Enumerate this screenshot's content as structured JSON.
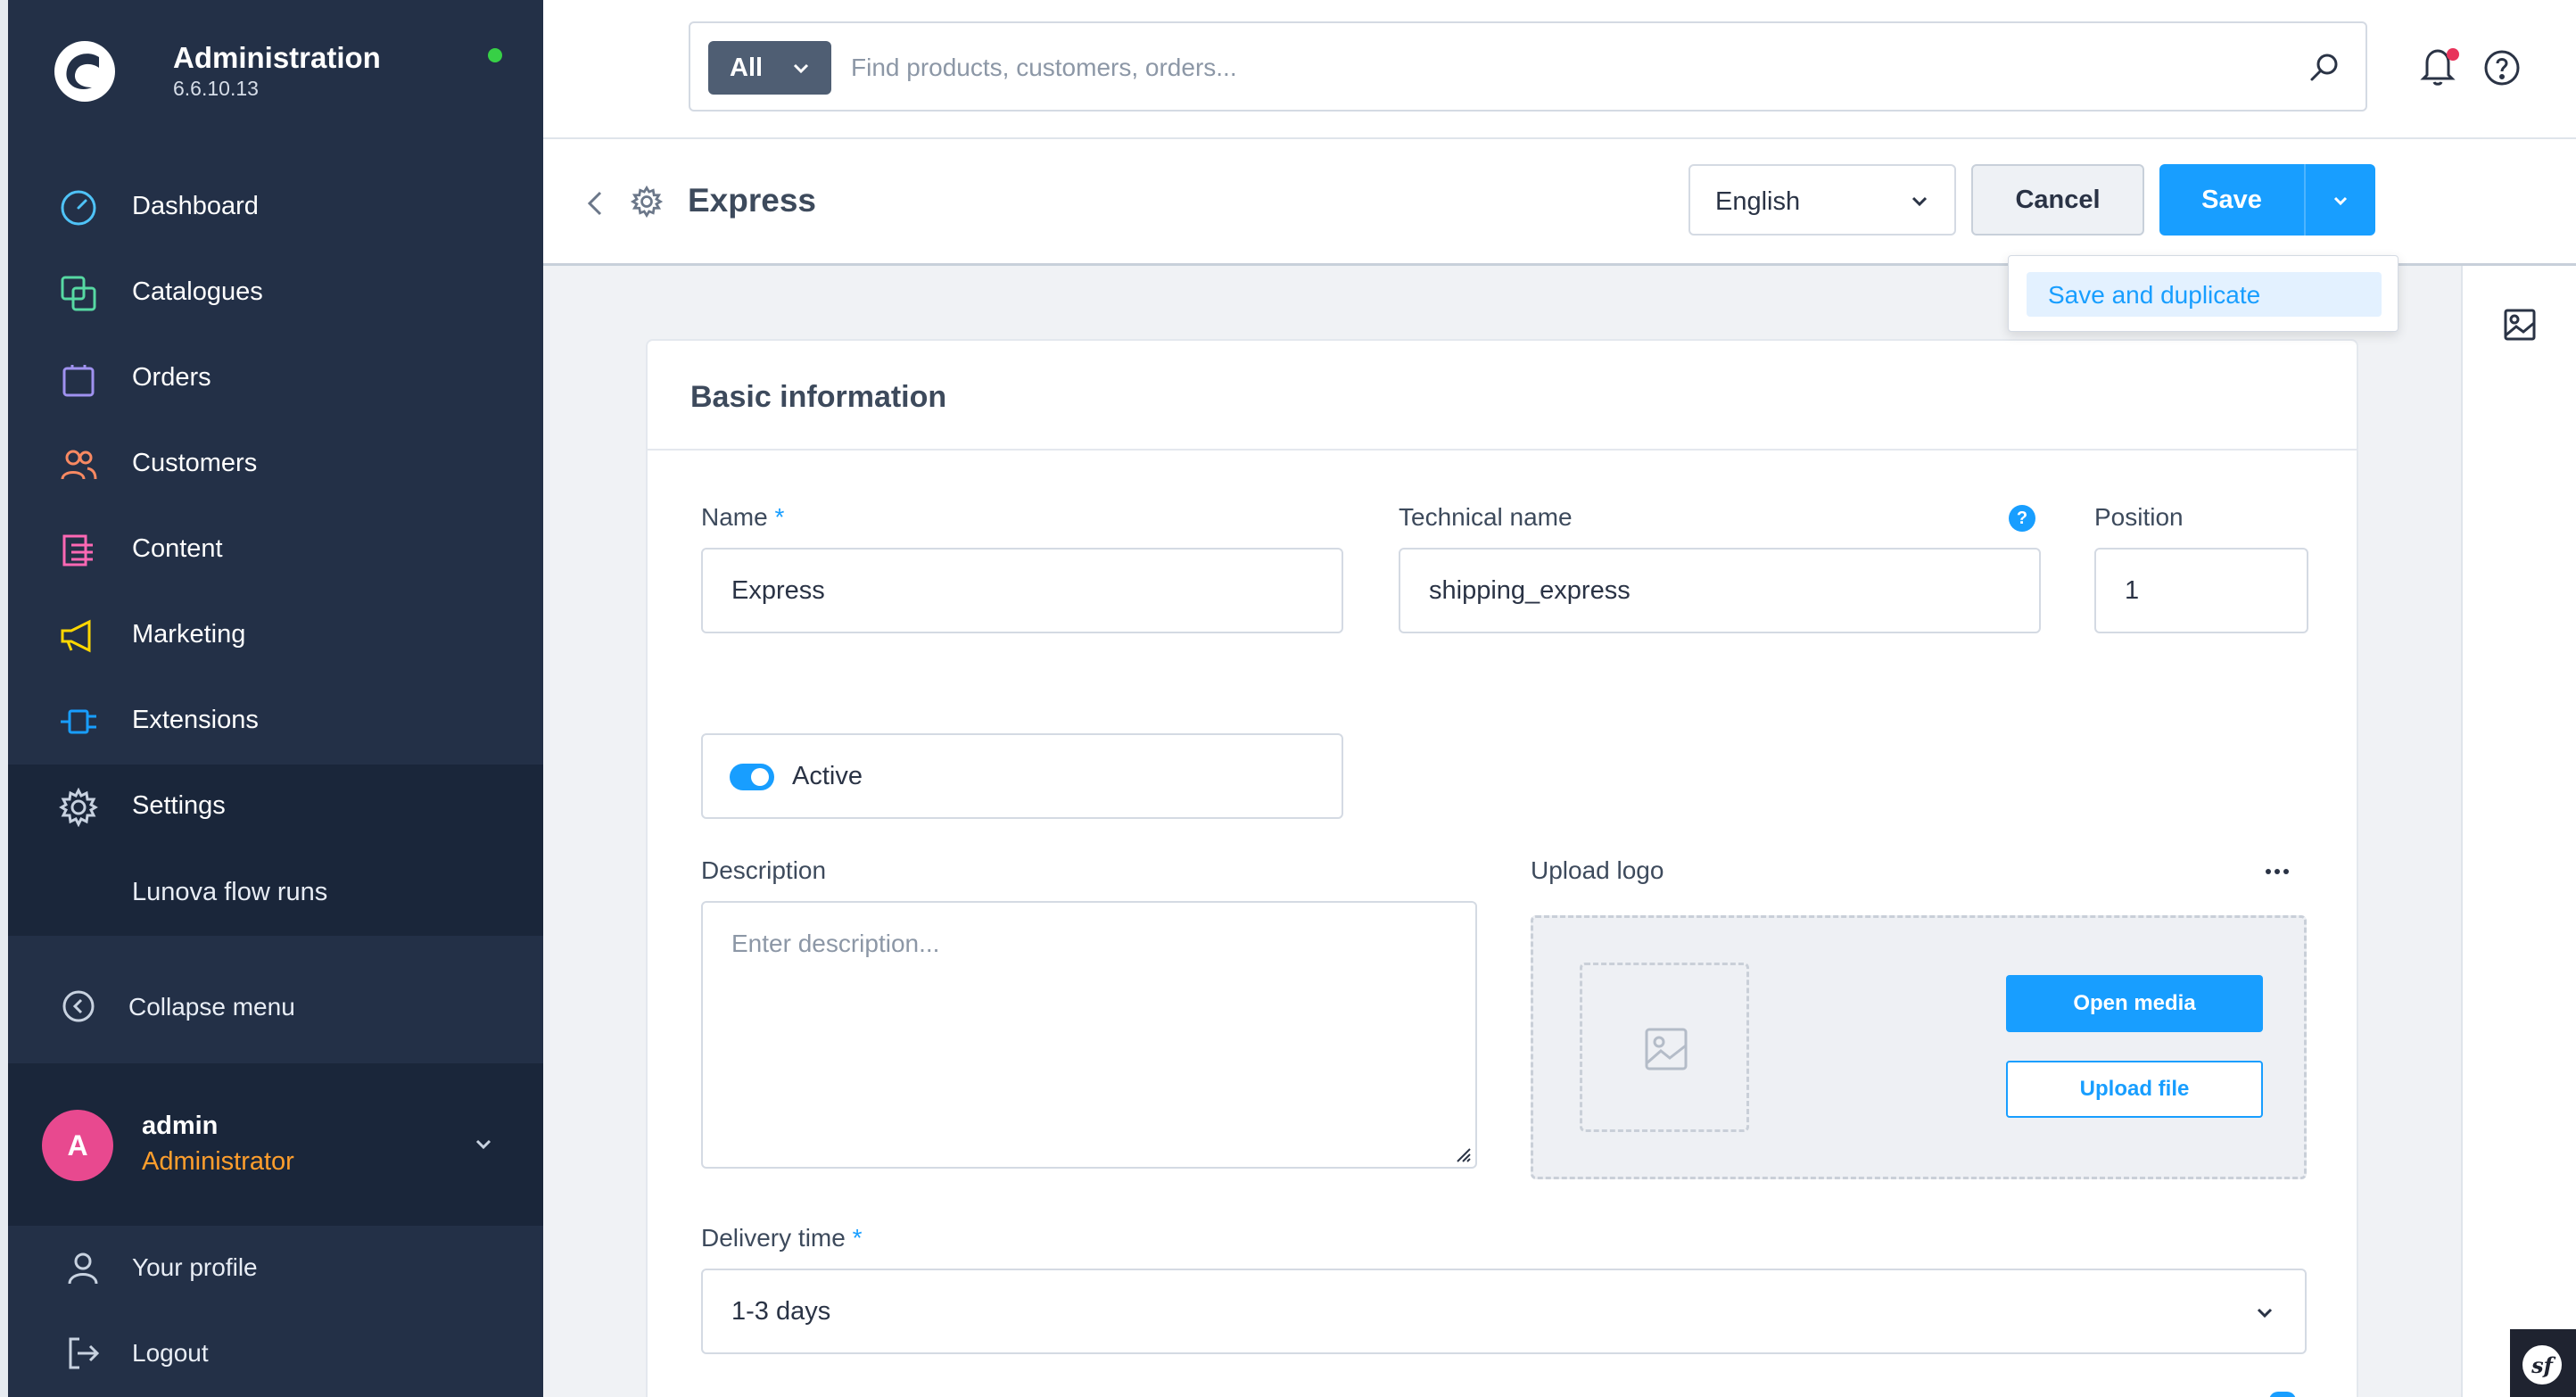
{
  "brand": {
    "title": "Administration",
    "version": "6.6.10.13"
  },
  "sidebar": {
    "items": [
      {
        "label": "Dashboard",
        "icon": "gauge-icon",
        "color": "#4fc3f7"
      },
      {
        "label": "Catalogues",
        "icon": "catalogue-icon",
        "color": "#57d9a3"
      },
      {
        "label": "Orders",
        "icon": "bag-icon",
        "color": "#a092f0"
      },
      {
        "label": "Customers",
        "icon": "users-icon",
        "color": "#f88962"
      },
      {
        "label": "Content",
        "icon": "content-icon",
        "color": "#ff68b4"
      },
      {
        "label": "Marketing",
        "icon": "megaphone-icon",
        "color": "#ffd700"
      },
      {
        "label": "Extensions",
        "icon": "plug-icon",
        "color": "#189eff"
      },
      {
        "label": "Settings",
        "icon": "gear-icon",
        "color": "#9aa8bd"
      }
    ],
    "sub_item": "Lunova flow runs",
    "collapse_label": "Collapse menu"
  },
  "user": {
    "initial": "A",
    "name": "admin",
    "role": "Administrator"
  },
  "account": {
    "profile_label": "Your profile",
    "logout_label": "Logout"
  },
  "search": {
    "scope": "All",
    "placeholder": "Find products, customers, orders..."
  },
  "header": {
    "title": "Express",
    "language": "English",
    "cancel_label": "Cancel",
    "save_label": "Save",
    "dropdown_item": "Save and duplicate"
  },
  "card": {
    "title": "Basic information",
    "name_label": "Name",
    "name_value": "Express",
    "technical_name_label": "Technical name",
    "technical_name_value": "shipping_express",
    "info_mark": "?",
    "position_label": "Position",
    "position_value": "1",
    "active_label": "Active",
    "active": true,
    "required_mark": "*",
    "description_label": "Description",
    "description_placeholder": "Enter description...",
    "upload_logo_label": "Upload logo",
    "open_media_label": "Open media",
    "upload_file_label": "Upload file",
    "delivery_time_label": "Delivery time",
    "delivery_time_value": "1-3 days"
  },
  "misc": {
    "symfony_mark": "sf"
  },
  "colors": {
    "accent": "#189eff",
    "sidebar_bg": "#233047",
    "role": "#ff9e2c",
    "avatar": "#e8498f"
  }
}
